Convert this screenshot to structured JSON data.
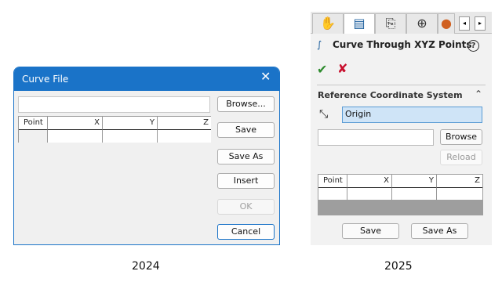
{
  "left_dialog": {
    "title": "Curve File",
    "close_glyph": "✕",
    "columns": [
      "Point",
      "X",
      "Y",
      "Z"
    ],
    "buttons": {
      "browse": "Browse...",
      "save": "Save",
      "save_as": "Save As",
      "insert": "Insert",
      "ok": "OK",
      "cancel": "Cancel"
    },
    "accent_color": "#1a73c8"
  },
  "right_panel": {
    "tabs": [
      "feature-manager-icon",
      "property-manager-icon",
      "configuration-manager-icon",
      "dimxpert-icon",
      "appearance-icon"
    ],
    "title": "Curve Through XYZ Points",
    "help_glyph": "?",
    "ok_glyph": "✔",
    "cancel_glyph": "✘",
    "section_title": "Reference Coordinate System",
    "coordinate_system": "Origin",
    "buttons": {
      "browse": "Browse",
      "reload": "Reload",
      "save": "Save",
      "save_as": "Save As"
    },
    "columns": [
      "Point",
      "X",
      "Y",
      "Z"
    ]
  },
  "captions": {
    "left": "2024",
    "right": "2025"
  }
}
